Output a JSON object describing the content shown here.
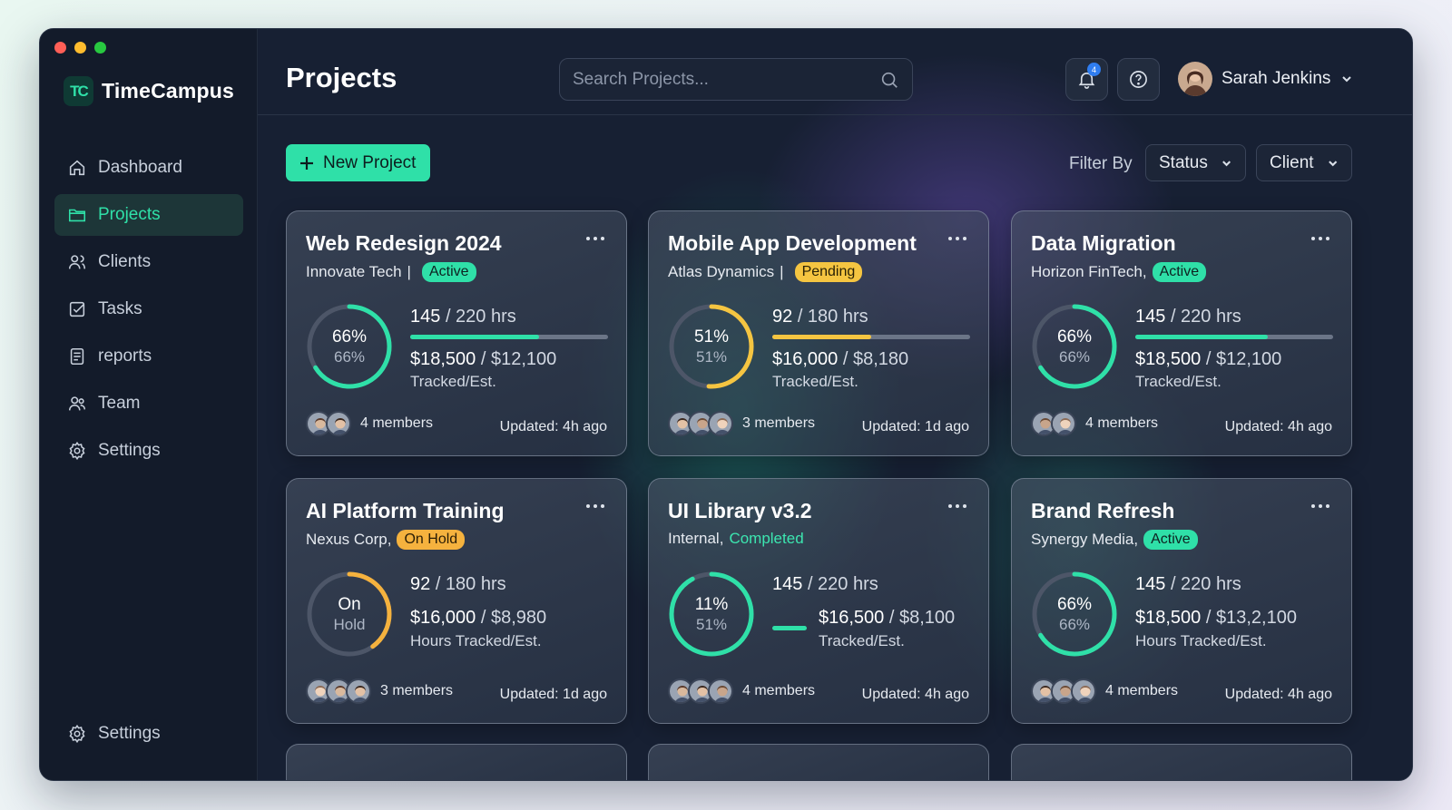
{
  "app": {
    "name": "TimeCampus",
    "logo_text": "TC"
  },
  "sidebar": {
    "items": [
      {
        "label": "Dashboard",
        "icon": "home-icon"
      },
      {
        "label": "Projects",
        "icon": "folder-icon",
        "active": true
      },
      {
        "label": "Clients",
        "icon": "users-icon"
      },
      {
        "label": "Tasks",
        "icon": "checkbox-icon"
      },
      {
        "label": "reports",
        "icon": "report-icon"
      },
      {
        "label": "Team",
        "icon": "team-icon"
      },
      {
        "label": "Settings",
        "icon": "gear-icon"
      }
    ],
    "bottom": {
      "label": "Settings",
      "icon": "gear-icon"
    }
  },
  "header": {
    "title": "Projects",
    "search_placeholder": "Search Projects...",
    "notifications_count": "4",
    "user_name": "Sarah Jenkins"
  },
  "toolbar": {
    "new_project_label": "New Project",
    "filter_label": "Filter By",
    "status_label": "Status",
    "client_label": "Client"
  },
  "colors": {
    "accent": "#2fe0a8",
    "warning": "#f5c541",
    "onhold": "#f5b23e"
  },
  "projects": [
    {
      "title": "Web Redesign 2024",
      "client": "Innovate Tech",
      "sep": "|",
      "status": "Active",
      "status_style": "active",
      "ring_main": "66%",
      "ring_sub": "66%",
      "progress": 0.66,
      "ring_color": "#2fe0a8",
      "hrs_tracked": "145",
      "hrs_est": "/ 220 hrs",
      "bar_fill": 0.65,
      "bar_color": "#2fe0a8",
      "money_tracked": "$18,500",
      "money_est": "/ $12,100",
      "tracked_label": "Tracked/Est.",
      "members": "4 members",
      "avatar_count": 2,
      "updated": "Updated: 4h ago"
    },
    {
      "title": "Mobile App Development",
      "client": "Atlas Dynamics",
      "sep": "|",
      "status": "Pending",
      "status_style": "pending",
      "ring_main": "51%",
      "ring_sub": "51%",
      "progress": 0.51,
      "ring_color": "#f5c541",
      "hrs_tracked": "92",
      "hrs_est": "/ 180 hrs",
      "bar_fill": 0.5,
      "bar_color": "#f5c541",
      "money_tracked": "$16,000",
      "money_est": "/ $8,180",
      "tracked_label": "Tracked/Est.",
      "members": "3 members",
      "avatar_count": 3,
      "updated": "Updated: 1d ago"
    },
    {
      "title": "Data Migration",
      "client": "Horizon FinTech,",
      "sep": "",
      "status": "Active",
      "status_style": "active",
      "ring_main": "66%",
      "ring_sub": "66%",
      "progress": 0.66,
      "ring_color": "#2fe0a8",
      "hrs_tracked": "145",
      "hrs_est": "/ 220 hrs",
      "bar_fill": 0.67,
      "bar_color": "#2fe0a8",
      "money_tracked": "$18,500",
      "money_est": "/ $12,100",
      "tracked_label": "Tracked/Est.",
      "members": "4 members",
      "avatar_count": 2,
      "updated": "Updated: 4h ago"
    },
    {
      "title": "AI Platform Training",
      "client": "Nexus Corp,",
      "sep": "",
      "status": "On Hold",
      "status_style": "onhold",
      "ring_main": "On",
      "ring_sub": "Hold",
      "progress": 0.4,
      "ring_color": "#f5b23e",
      "hrs_tracked": "92",
      "hrs_est": "/ 180 hrs",
      "bar_fill": 0,
      "bar_color": "#f5b23e",
      "money_tracked": "$16,000",
      "money_est": "/ $8,980",
      "tracked_label": "Hours Tracked/Est.",
      "members": "3 members",
      "avatar_count": 3,
      "updated": "Updated: 1d ago"
    },
    {
      "title": "UI Library v3.2",
      "client": "Internal,",
      "sep": "",
      "status": "Completed",
      "status_style": "completed",
      "ring_main": "11%",
      "ring_sub": "51%",
      "progress": 0.92,
      "ring_color": "#2fe0a8",
      "hrs_tracked": "145",
      "hrs_est": "/ 220 hrs",
      "bar_fill": 0,
      "bar_color": "#2fe0a8",
      "money_tracked": "$16,500",
      "money_est": "/ $8,100",
      "tracked_label": "Tracked/Est.",
      "members": "4 members",
      "avatar_count": 3,
      "updated": "Updated: 4h ago",
      "mini_dash": true
    },
    {
      "title": "Brand Refresh",
      "client": "Synergy Media,",
      "sep": "",
      "status": "Active",
      "status_style": "active",
      "ring_main": "66%",
      "ring_sub": "66%",
      "progress": 0.66,
      "ring_color": "#2fe0a8",
      "hrs_tracked": "145",
      "hrs_est": "/ 220 hrs",
      "bar_fill": 0,
      "bar_color": "#2fe0a8",
      "money_tracked": "$18,500",
      "money_est": "/ $13,2,100",
      "tracked_label": "Hours Tracked/Est.",
      "members": "4 members",
      "avatar_count": 3,
      "updated": "Updated: 4h ago"
    }
  ]
}
